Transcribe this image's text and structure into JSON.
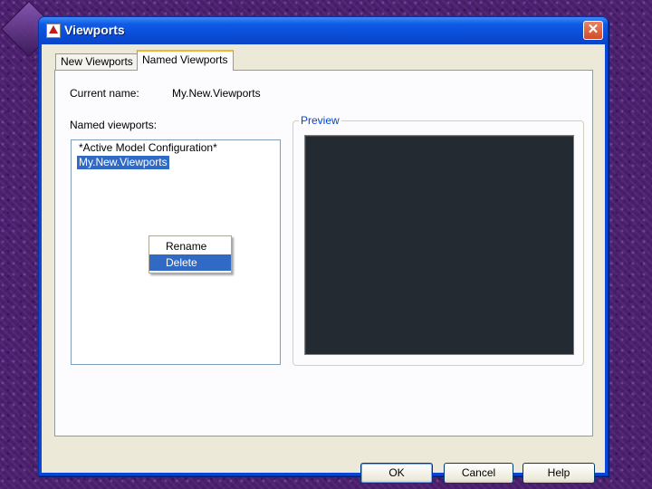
{
  "window": {
    "title": "Viewports",
    "close_glyph": "✕"
  },
  "tabs": [
    {
      "label": "New Viewports",
      "active": false
    },
    {
      "label": "Named Viewports",
      "active": true
    }
  ],
  "current_name": {
    "label": "Current name:",
    "value": "My.New.Viewports"
  },
  "named_viewports": {
    "label": "Named viewports:",
    "items": [
      {
        "label": "*Active Model Configuration*",
        "selected": false
      },
      {
        "label": "My.New.Viewports",
        "selected": true
      }
    ]
  },
  "context_menu": {
    "items": [
      {
        "label": "Rename",
        "highlighted": false
      },
      {
        "label": "Delete",
        "highlighted": true
      }
    ]
  },
  "preview": {
    "label": "Preview"
  },
  "buttons": {
    "ok": "OK",
    "cancel": "Cancel",
    "help": "Help"
  },
  "colors": {
    "selection": "#316ac5",
    "titlebar": "#0a4ed8",
    "preview_bg": "#232a31"
  }
}
